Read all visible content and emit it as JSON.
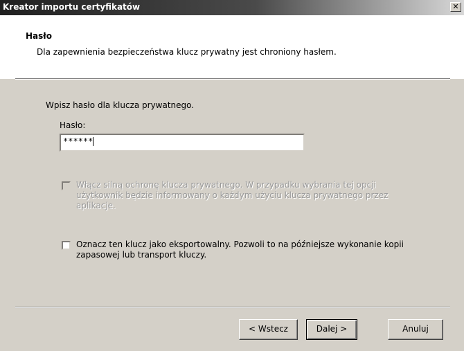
{
  "window": {
    "title": "Kreator importu certyfikatów",
    "close_symbol": "✕"
  },
  "header": {
    "title": "Hasło",
    "subtitle": "Dla zapewnienia bezpieczeństwa klucz prywatny jest chroniony hasłem."
  },
  "body": {
    "prompt": "Wpisz hasło dla klucza prywatnego.",
    "password_label": "Hasło:",
    "password_value": "******",
    "strong_protection": {
      "checked": false,
      "enabled": false,
      "label": "Włącz silną ochronę klucza prywatnego. W przypadku wybrania tej opcji użytkownik będzie informowany o każdym użyciu klucza prywatnego przez aplikacje."
    },
    "exportable": {
      "checked": false,
      "enabled": true,
      "label": "Oznacz ten klucz jako eksportowalny. Pozwoli to na późniejsze wykonanie kopii zapasowej lub transport kluczy."
    }
  },
  "buttons": {
    "back": "< Wstecz",
    "next": "Dalej >",
    "cancel": "Anuluj"
  }
}
